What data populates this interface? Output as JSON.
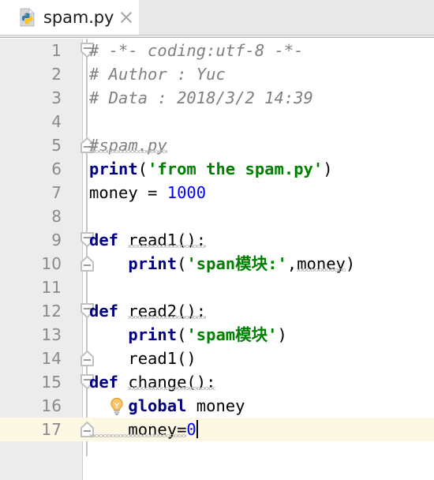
{
  "window": {
    "app": "pycharm-editor"
  },
  "tabbar": {
    "tabs": [
      {
        "title": "spam.py",
        "icon": "python-file-icon",
        "active": true,
        "close_icon": "close-icon"
      }
    ]
  },
  "editor": {
    "language": "python",
    "current_line": 17,
    "caret": {
      "line": 17,
      "column": 8
    },
    "colors": {
      "gutter_bg": "#ececec",
      "editor_bg": "#ffffff",
      "current_line_bg": "#fdf8e4",
      "line_number": "#8a8a8a",
      "comment": "#808080",
      "keyword": "#000080",
      "string": "#008000",
      "number": "#0000ff",
      "text": "#000000",
      "squiggle": "#bdbdbd"
    },
    "lines": [
      {
        "number": "1",
        "fold": "collapse-down",
        "tokens": [
          {
            "text": "# -*- coding:utf-8 -*-",
            "type": "comment"
          }
        ]
      },
      {
        "number": "2",
        "tokens": [
          {
            "text": "# Author : Yuc",
            "type": "comment"
          }
        ]
      },
      {
        "number": "3",
        "tokens": [
          {
            "text": "# Data : 2018/3/2 14:39",
            "type": "comment"
          }
        ]
      },
      {
        "number": "4",
        "tokens": []
      },
      {
        "number": "5",
        "fold": "collapse-up",
        "tokens": [
          {
            "text": "#spam.py",
            "type": "comment",
            "squiggle": true
          }
        ]
      },
      {
        "number": "6",
        "tokens": [
          {
            "text": "print",
            "type": "keyword"
          },
          {
            "text": "(",
            "type": "punc"
          },
          {
            "text": "'from the spam.py'",
            "type": "string"
          },
          {
            "text": ")",
            "type": "punc"
          }
        ]
      },
      {
        "number": "7",
        "tokens": [
          {
            "text": "money = ",
            "type": "plain"
          },
          {
            "text": "1000",
            "type": "number"
          }
        ]
      },
      {
        "number": "8",
        "tokens": []
      },
      {
        "number": "9",
        "fold": "collapse-down",
        "tokens": [
          {
            "text": "def ",
            "type": "keyword"
          },
          {
            "text": "read1():",
            "type": "plain",
            "squiggle": true
          }
        ]
      },
      {
        "number": "10",
        "fold": "collapse-up",
        "tokens": [
          {
            "text": "    ",
            "type": "plain"
          },
          {
            "text": "print",
            "type": "keyword"
          },
          {
            "text": "(",
            "type": "punc"
          },
          {
            "text": "'span模块:'",
            "type": "string"
          },
          {
            "text": ",",
            "type": "punc"
          },
          {
            "text": "money",
            "type": "plain",
            "squiggle": true
          },
          {
            "text": ")",
            "type": "punc"
          }
        ]
      },
      {
        "number": "11",
        "tokens": []
      },
      {
        "number": "12",
        "fold": "collapse-down",
        "tokens": [
          {
            "text": "def ",
            "type": "keyword"
          },
          {
            "text": "read2():",
            "type": "plain",
            "squiggle": true
          }
        ]
      },
      {
        "number": "13",
        "tokens": [
          {
            "text": "    ",
            "type": "plain"
          },
          {
            "text": "print",
            "type": "keyword"
          },
          {
            "text": "(",
            "type": "punc"
          },
          {
            "text": "'spam模块'",
            "type": "string"
          },
          {
            "text": ")",
            "type": "punc"
          }
        ]
      },
      {
        "number": "14",
        "fold": "collapse-up",
        "tokens": [
          {
            "text": "    read1()",
            "type": "plain"
          }
        ]
      },
      {
        "number": "15",
        "fold": "collapse-down",
        "tokens": [
          {
            "text": "def ",
            "type": "keyword"
          },
          {
            "text": "change():",
            "type": "plain",
            "squiggle": true
          }
        ]
      },
      {
        "number": "16",
        "bulb": "intention-bulb-icon",
        "tokens": [
          {
            "text": "    ",
            "type": "plain"
          },
          {
            "text": "global ",
            "type": "keyword"
          },
          {
            "text": "money",
            "type": "plain"
          }
        ]
      },
      {
        "number": "17",
        "fold": "collapse-up",
        "current": true,
        "caret_after": true,
        "tokens": [
          {
            "text": "    money=",
            "type": "plain",
            "squiggle_tail": true
          },
          {
            "text": "0",
            "type": "number"
          }
        ]
      }
    ]
  }
}
